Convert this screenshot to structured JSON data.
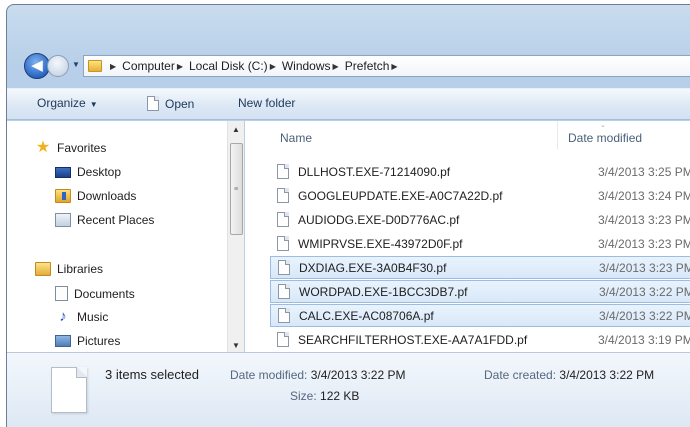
{
  "address": {
    "breadcrumbs": [
      "Computer",
      "Local Disk (C:)",
      "Windows",
      "Prefetch"
    ]
  },
  "toolbar": {
    "organize": "Organize",
    "open": "Open",
    "new_folder": "New folder"
  },
  "nav": {
    "favorites": "Favorites",
    "desktop": "Desktop",
    "downloads": "Downloads",
    "recent_places": "Recent Places",
    "libraries": "Libraries",
    "documents": "Documents",
    "music": "Music",
    "pictures": "Pictures"
  },
  "columns": {
    "name": "Name",
    "date_modified": "Date modified"
  },
  "files": [
    {
      "name": "DLLHOST.EXE-71214090.pf",
      "date": "3/4/2013 3:25 PM",
      "selected": false
    },
    {
      "name": "GOOGLEUPDATE.EXE-A0C7A22D.pf",
      "date": "3/4/2013 3:24 PM",
      "selected": false
    },
    {
      "name": "AUDIODG.EXE-D0D776AC.pf",
      "date": "3/4/2013 3:23 PM",
      "selected": false
    },
    {
      "name": "WMIPRVSE.EXE-43972D0F.pf",
      "date": "3/4/2013 3:23 PM",
      "selected": false
    },
    {
      "name": "DXDIAG.EXE-3A0B4F30.pf",
      "date": "3/4/2013 3:23 PM",
      "selected": true
    },
    {
      "name": "WORDPAD.EXE-1BCC3DB7.pf",
      "date": "3/4/2013 3:22 PM",
      "selected": true
    },
    {
      "name": "CALC.EXE-AC08706A.pf",
      "date": "3/4/2013 3:22 PM",
      "selected": true
    },
    {
      "name": "SEARCHFILTERHOST.EXE-AA7A1FDD.pf",
      "date": "3/4/2013 3:19 PM",
      "selected": false
    }
  ],
  "details": {
    "selection_count": "3 items selected",
    "date_modified_label": "Date modified:",
    "date_modified_value": "3/4/2013 3:22 PM",
    "size_label": "Size:",
    "size_value": "122 KB",
    "date_created_label": "Date created:",
    "date_created_value": "3/4/2013 3:22 PM"
  }
}
